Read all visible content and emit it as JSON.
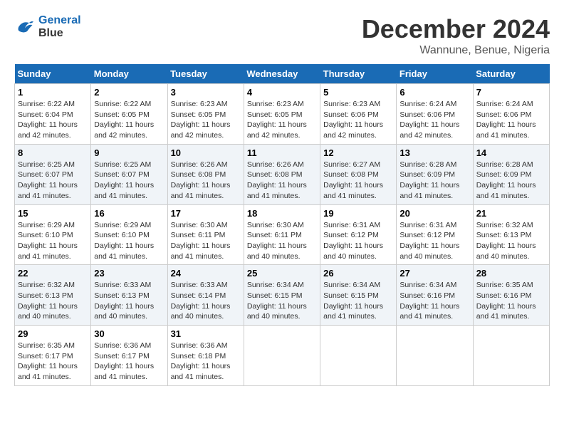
{
  "logo": {
    "line1": "General",
    "line2": "Blue"
  },
  "title": "December 2024",
  "location": "Wannune, Benue, Nigeria",
  "weekdays": [
    "Sunday",
    "Monday",
    "Tuesday",
    "Wednesday",
    "Thursday",
    "Friday",
    "Saturday"
  ],
  "weeks": [
    [
      {
        "day": "1",
        "sunrise": "6:22 AM",
        "sunset": "6:04 PM",
        "daylight": "11 hours and 42 minutes."
      },
      {
        "day": "2",
        "sunrise": "6:22 AM",
        "sunset": "6:05 PM",
        "daylight": "11 hours and 42 minutes."
      },
      {
        "day": "3",
        "sunrise": "6:23 AM",
        "sunset": "6:05 PM",
        "daylight": "11 hours and 42 minutes."
      },
      {
        "day": "4",
        "sunrise": "6:23 AM",
        "sunset": "6:05 PM",
        "daylight": "11 hours and 42 minutes."
      },
      {
        "day": "5",
        "sunrise": "6:23 AM",
        "sunset": "6:06 PM",
        "daylight": "11 hours and 42 minutes."
      },
      {
        "day": "6",
        "sunrise": "6:24 AM",
        "sunset": "6:06 PM",
        "daylight": "11 hours and 42 minutes."
      },
      {
        "day": "7",
        "sunrise": "6:24 AM",
        "sunset": "6:06 PM",
        "daylight": "11 hours and 41 minutes."
      }
    ],
    [
      {
        "day": "8",
        "sunrise": "6:25 AM",
        "sunset": "6:07 PM",
        "daylight": "11 hours and 41 minutes."
      },
      {
        "day": "9",
        "sunrise": "6:25 AM",
        "sunset": "6:07 PM",
        "daylight": "11 hours and 41 minutes."
      },
      {
        "day": "10",
        "sunrise": "6:26 AM",
        "sunset": "6:08 PM",
        "daylight": "11 hours and 41 minutes."
      },
      {
        "day": "11",
        "sunrise": "6:26 AM",
        "sunset": "6:08 PM",
        "daylight": "11 hours and 41 minutes."
      },
      {
        "day": "12",
        "sunrise": "6:27 AM",
        "sunset": "6:08 PM",
        "daylight": "11 hours and 41 minutes."
      },
      {
        "day": "13",
        "sunrise": "6:28 AM",
        "sunset": "6:09 PM",
        "daylight": "11 hours and 41 minutes."
      },
      {
        "day": "14",
        "sunrise": "6:28 AM",
        "sunset": "6:09 PM",
        "daylight": "11 hours and 41 minutes."
      }
    ],
    [
      {
        "day": "15",
        "sunrise": "6:29 AM",
        "sunset": "6:10 PM",
        "daylight": "11 hours and 41 minutes."
      },
      {
        "day": "16",
        "sunrise": "6:29 AM",
        "sunset": "6:10 PM",
        "daylight": "11 hours and 41 minutes."
      },
      {
        "day": "17",
        "sunrise": "6:30 AM",
        "sunset": "6:11 PM",
        "daylight": "11 hours and 41 minutes."
      },
      {
        "day": "18",
        "sunrise": "6:30 AM",
        "sunset": "6:11 PM",
        "daylight": "11 hours and 40 minutes."
      },
      {
        "day": "19",
        "sunrise": "6:31 AM",
        "sunset": "6:12 PM",
        "daylight": "11 hours and 40 minutes."
      },
      {
        "day": "20",
        "sunrise": "6:31 AM",
        "sunset": "6:12 PM",
        "daylight": "11 hours and 40 minutes."
      },
      {
        "day": "21",
        "sunrise": "6:32 AM",
        "sunset": "6:13 PM",
        "daylight": "11 hours and 40 minutes."
      }
    ],
    [
      {
        "day": "22",
        "sunrise": "6:32 AM",
        "sunset": "6:13 PM",
        "daylight": "11 hours and 40 minutes."
      },
      {
        "day": "23",
        "sunrise": "6:33 AM",
        "sunset": "6:13 PM",
        "daylight": "11 hours and 40 minutes."
      },
      {
        "day": "24",
        "sunrise": "6:33 AM",
        "sunset": "6:14 PM",
        "daylight": "11 hours and 40 minutes."
      },
      {
        "day": "25",
        "sunrise": "6:34 AM",
        "sunset": "6:15 PM",
        "daylight": "11 hours and 40 minutes."
      },
      {
        "day": "26",
        "sunrise": "6:34 AM",
        "sunset": "6:15 PM",
        "daylight": "11 hours and 41 minutes."
      },
      {
        "day": "27",
        "sunrise": "6:34 AM",
        "sunset": "6:16 PM",
        "daylight": "11 hours and 41 minutes."
      },
      {
        "day": "28",
        "sunrise": "6:35 AM",
        "sunset": "6:16 PM",
        "daylight": "11 hours and 41 minutes."
      }
    ],
    [
      {
        "day": "29",
        "sunrise": "6:35 AM",
        "sunset": "6:17 PM",
        "daylight": "11 hours and 41 minutes."
      },
      {
        "day": "30",
        "sunrise": "6:36 AM",
        "sunset": "6:17 PM",
        "daylight": "11 hours and 41 minutes."
      },
      {
        "day": "31",
        "sunrise": "6:36 AM",
        "sunset": "6:18 PM",
        "daylight": "11 hours and 41 minutes."
      },
      null,
      null,
      null,
      null
    ]
  ],
  "labels": {
    "sunrise": "Sunrise:",
    "sunset": "Sunset:",
    "daylight": "Daylight:"
  }
}
